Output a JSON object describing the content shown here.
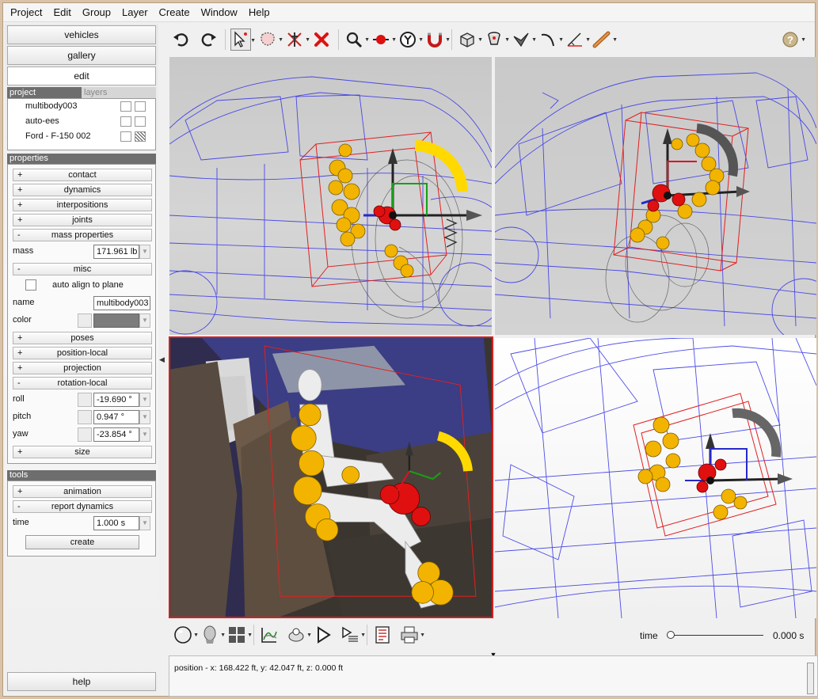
{
  "menu": [
    "Project",
    "Edit",
    "Group",
    "Layer",
    "Create",
    "Window",
    "Help"
  ],
  "left": {
    "buttons": {
      "vehicles": "vehicles",
      "gallery": "gallery",
      "edit": "edit"
    },
    "tabs": {
      "project": "project",
      "layers": "layers"
    },
    "objects": [
      {
        "label": "multibody003"
      },
      {
        "label": "auto-ees"
      },
      {
        "label": "Ford - F-150 002"
      }
    ],
    "properties_header": "properties",
    "groups": {
      "contact": "contact",
      "dynamics": "dynamics",
      "interpositions": "interpositions",
      "joints": "joints",
      "mass_properties": "mass properties",
      "misc": "misc",
      "poses": "poses",
      "position_local": "position-local",
      "projection": "projection",
      "rotation_local": "rotation-local",
      "size": "size"
    },
    "signs": {
      "plus": "+",
      "minus": "-"
    },
    "mass": {
      "label": "mass",
      "value": "171.961 lb"
    },
    "misc": {
      "auto_align_label": "auto align to plane",
      "name_label": "name",
      "name_value": "multibody003",
      "color_label": "color",
      "color_value": "#7c7c7c"
    },
    "rotation": {
      "roll_label": "roll",
      "roll_value": "-19.690 °",
      "pitch_label": "pitch",
      "pitch_value": "0.947 °",
      "yaw_label": "yaw",
      "yaw_value": "-23.854 °"
    },
    "tools_header": "tools",
    "tools": {
      "animation": "animation",
      "report_dynamics": "report dynamics",
      "time_label": "time",
      "time_value": "1.000 s",
      "create": "create"
    },
    "help": "help"
  },
  "toolbar_icons": [
    "undo-icon",
    "redo-icon",
    "select-arrow-icon",
    "lasso-icon",
    "pin-icon",
    "delete-x-icon",
    "zoom-icon",
    "move-icon",
    "y-axis-icon",
    "magnet-icon",
    "cube-icon",
    "camera-mount-icon",
    "plane-icon",
    "curve-icon",
    "measure-icon",
    "ruler-stick-icon",
    "help-icon"
  ],
  "bottom": {
    "time_label": "time",
    "time_value": "0.000 s",
    "playback": 0.0
  },
  "status": {
    "position_text": "position - x: 168.422 ft, y: 42.047 ft, z: 0.000 ft"
  },
  "colors": {
    "wireframe": "#3a3ae8",
    "bounding_box": "#e02020",
    "dummy_limbs": "#f2b400",
    "joint_red": "#e01010",
    "active_viewport_border": "#d42020"
  }
}
